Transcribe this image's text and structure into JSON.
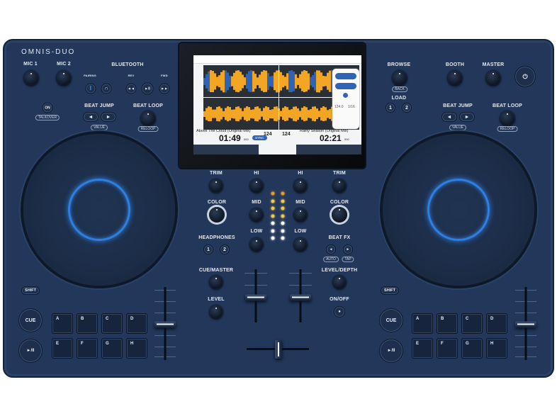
{
  "brand": "OMNIS-DUO",
  "left": {
    "mic1": "MIC 1",
    "mic2": "MIC 2",
    "bluetooth": "BLUETOOTH",
    "pairing": "PAIRING",
    "rev": "REV",
    "fwd": "FWD",
    "on": "ON",
    "talkover": "TALKOVER",
    "beat_jump": "BEAT JUMP",
    "value": "VALUE",
    "beat_loop": "BEAT LOOP",
    "reloop": "RELOOP",
    "shift": "SHIFT",
    "cue": "CUE",
    "play": "►/II",
    "pads": [
      "A",
      "B",
      "C",
      "D",
      "E",
      "F",
      "G",
      "H"
    ]
  },
  "right": {
    "browse": "BROWSE",
    "back": "BACK",
    "load": "LOAD",
    "load1": "1",
    "load2": "2",
    "booth": "BOOTH",
    "master": "MASTER",
    "beat_jump": "BEAT JUMP",
    "value": "VALUE",
    "beat_loop": "BEAT LOOP",
    "reloop": "RELOOP",
    "shift": "SHIFT",
    "cue": "CUE",
    "play": "►/II",
    "pads": [
      "A",
      "B",
      "C",
      "D",
      "E",
      "F",
      "G",
      "H"
    ]
  },
  "mixer": {
    "trim": "TRIM",
    "hi": "HI",
    "mid": "MID",
    "low": "LOW",
    "color": "COLOR",
    "headphones": "HEADPHONES",
    "hp1": "1",
    "hp2": "2",
    "beat_fx": "BEAT FX",
    "auto": "AUTO",
    "tap": "TAP",
    "cue_master": "CUE/MASTER",
    "level": "LEVEL",
    "level_depth": "LEVEL/DEPTH",
    "on_off": "ON/OFF"
  },
  "screen": {
    "deck1": {
      "title": "Above The Cloud (Original Mix)",
      "time": "01:49",
      "ms": "000",
      "bpm": "124",
      "sync": "SYNC"
    },
    "deck2": {
      "title": "Rainy Season (Original Mix)",
      "time": "02:21",
      "ms": "000",
      "bpm": "124"
    },
    "fx_bpm": "124.0",
    "fx_beat": "1/16"
  },
  "colors": {
    "body": "#22375a",
    "jog_ring": "#2f7fe0",
    "wave": "#f2a623",
    "wave_blue": "#2e63b5"
  }
}
